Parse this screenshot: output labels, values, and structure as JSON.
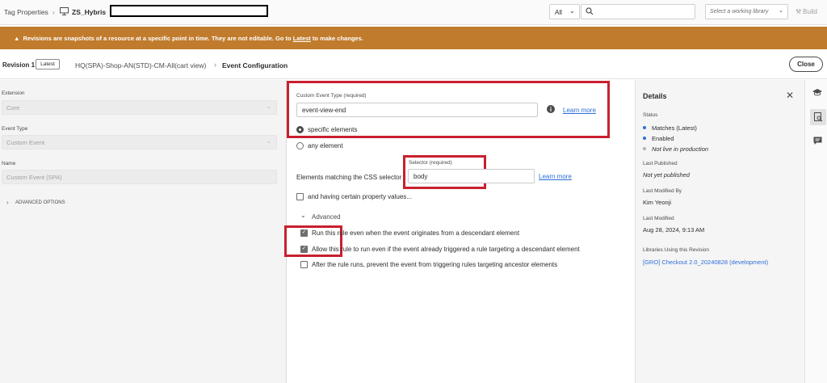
{
  "topbar": {
    "crumb_root": "Tag Properties",
    "property_name": "ZS_Hybris",
    "filter_value": "All",
    "search_placeholder": "",
    "library_placeholder": "Select a working library",
    "build_label": "Build"
  },
  "banner": {
    "text_before": "Revisions are snapshots of a resource at a specific point in time. They are not editable. Go to ",
    "link": "Latest",
    "text_after": " to make changes."
  },
  "revision": {
    "label": "Revision 1",
    "badge": "Latest",
    "rule_name": "HQ(SPA)-Shop-AN(STD)-CM-All(cart view)",
    "page": "Event Configuration",
    "close_label": "Close"
  },
  "left": {
    "extension_label": "Extension",
    "extension_value": "Core",
    "event_type_label": "Event Type",
    "event_type_value": "Custom Event",
    "name_label": "Name",
    "name_value": "Custom Event (SPA)",
    "advanced_options": "ADVANCED OPTIONS"
  },
  "main": {
    "custom_event_label": "Custom Event Type (required)",
    "custom_event_value": "event-view-end",
    "learn_more": "Learn more",
    "radio_specific": "specific elements",
    "radio_any": "any element",
    "selector_label": "Selector (required)",
    "elements_matching": "Elements matching the CSS selector",
    "selector_value": "body",
    "property_values": "and having certain property values...",
    "advanced": "Advanced",
    "opt1": "Run this rule even when the event originates from a descendant element",
    "opt2": "Allow this rule to run even if the event already triggered a rule targeting a descendant element",
    "opt3": "After the rule runs, prevent the event from triggering rules targeting ancestor elements"
  },
  "details": {
    "title": "Details",
    "status_label": "Status",
    "status_items": [
      {
        "text": "Matches (Latest)",
        "color": "#2d6ed8"
      },
      {
        "text": "Enabled",
        "color": "#2d6ed8"
      },
      {
        "text": "Not live in production",
        "color": "#b3b3b3"
      }
    ],
    "last_published_label": "Last Published",
    "last_published_value": "Not yet published",
    "last_modified_by_label": "Last Modified By",
    "last_modified_by_value": "Kim Yeonji",
    "last_modified_label": "Last Modified",
    "last_modified_value": "Aug 28, 2024, 9:13 AM",
    "libraries_label": "Libraries Using this Revision",
    "library_link": "[GRO] Checkout 2.0_20240828 (development)"
  },
  "colors": {
    "banner": "#c07b2c",
    "highlight": "#c8202f",
    "link": "#2d6ed8"
  }
}
